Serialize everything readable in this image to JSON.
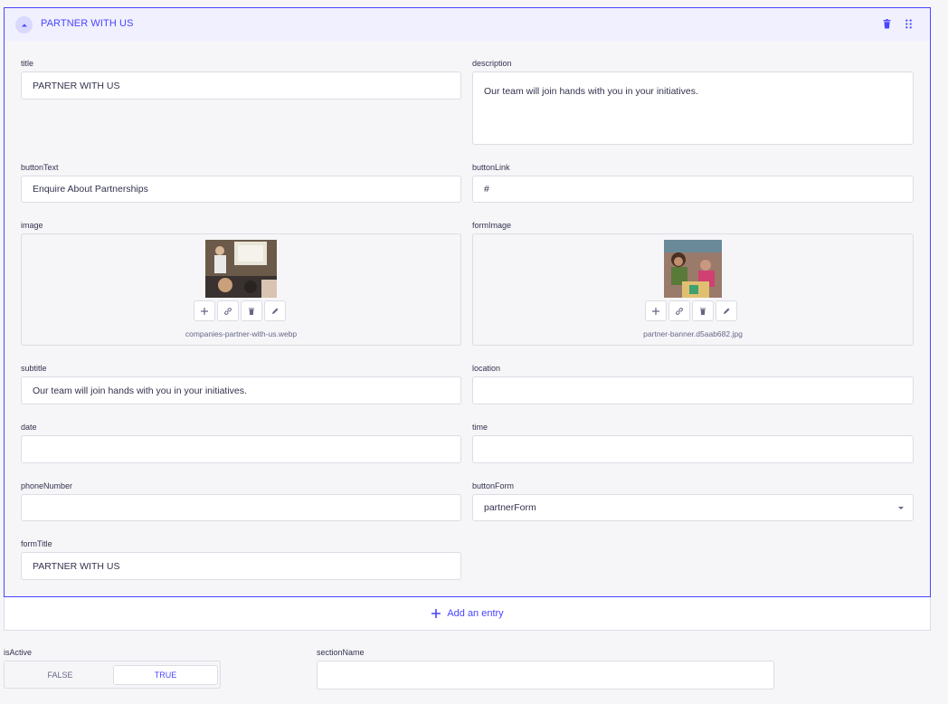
{
  "panel": {
    "title": "PARTNER WITH US"
  },
  "fields": {
    "title": {
      "label": "title",
      "value": "PARTNER WITH US"
    },
    "description": {
      "label": "description",
      "value": "Our team will join hands with you in your initiatives."
    },
    "buttonText": {
      "label": "buttonText",
      "value": "Enquire About Partnerships"
    },
    "buttonLink": {
      "label": "buttonLink",
      "value": "#"
    },
    "image": {
      "label": "image",
      "filename": "companies-partner-with-us.webp"
    },
    "formImage": {
      "label": "formImage",
      "filename": "partner-banner.d5aab682.jpg"
    },
    "subtitle": {
      "label": "subtitle",
      "value": "Our team will join hands with you in your initiatives."
    },
    "location": {
      "label": "location",
      "value": ""
    },
    "date": {
      "label": "date",
      "value": ""
    },
    "time": {
      "label": "time",
      "value": ""
    },
    "phoneNumber": {
      "label": "phoneNumber",
      "value": ""
    },
    "buttonForm": {
      "label": "buttonForm",
      "value": "partnerForm"
    },
    "formTitle": {
      "label": "formTitle",
      "value": "PARTNER WITH US"
    }
  },
  "add_entry": {
    "label": "Add an entry"
  },
  "isActive": {
    "label": "isActive",
    "false_label": "FALSE",
    "true_label": "TRUE",
    "selected": "TRUE"
  },
  "sectionName": {
    "label": "sectionName",
    "value": ""
  },
  "colors": {
    "accent": "#4945ff",
    "header_bg": "#f0f0ff",
    "page_bg": "#f6f6f9",
    "border": "#dcdce4"
  },
  "icons": [
    "chevron-up-icon",
    "trash-icon",
    "drag-icon",
    "plus-icon",
    "link-icon",
    "pencil-icon",
    "caret-down-icon"
  ]
}
